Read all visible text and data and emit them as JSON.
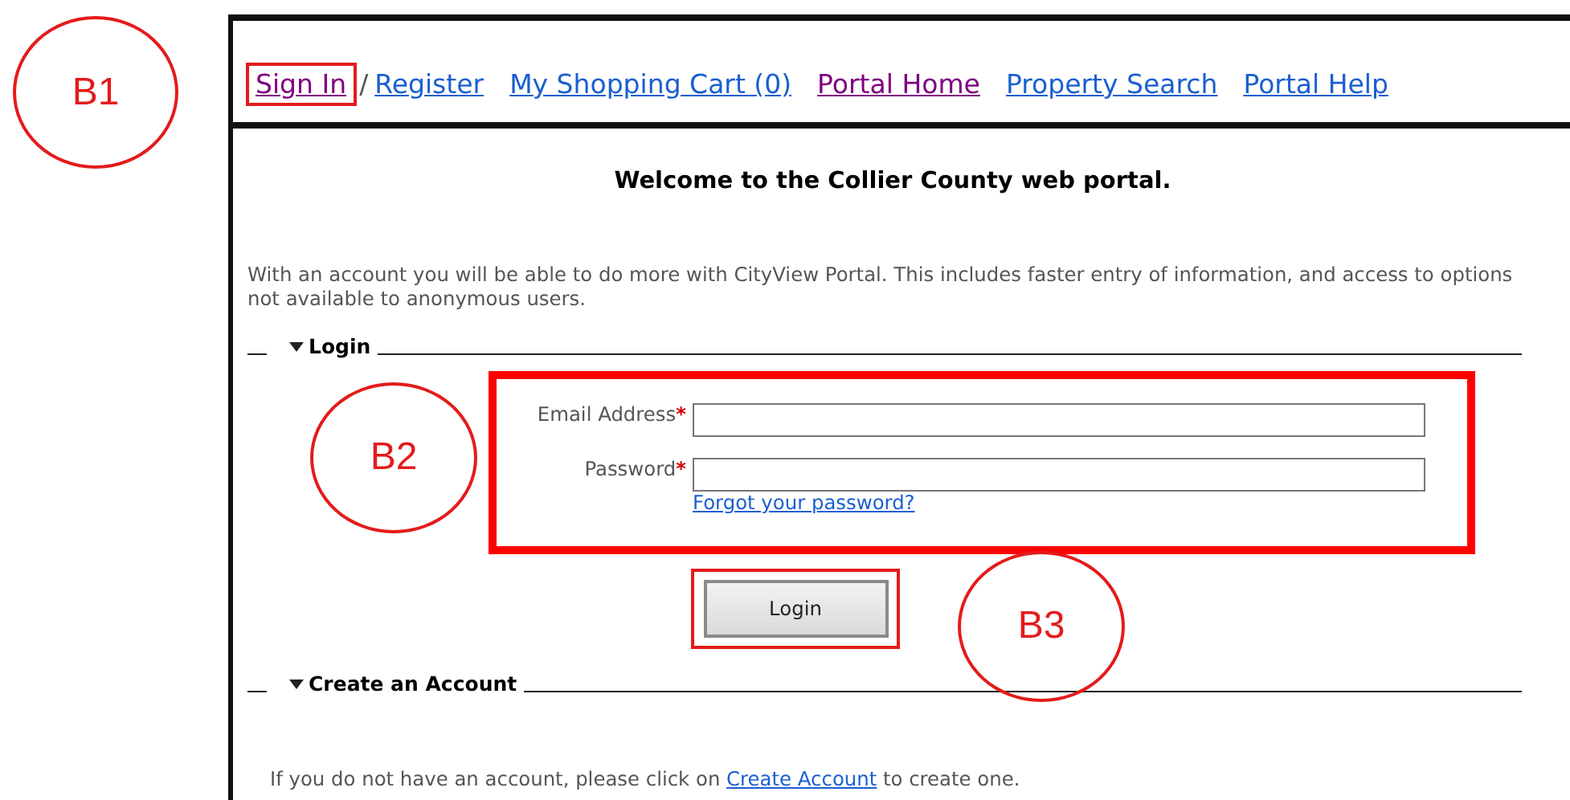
{
  "nav": {
    "callout": "B1",
    "links": [
      {
        "kind": "link",
        "label": "Sign In",
        "visited": true,
        "highlighted": true
      },
      {
        "kind": "separator",
        "label": "/"
      },
      {
        "kind": "link",
        "label": "Register",
        "visited": false,
        "highlighted": false
      },
      {
        "kind": "link",
        "label": "My Shopping Cart (0)",
        "visited": false,
        "highlighted": false
      },
      {
        "kind": "link",
        "label": "Portal Home",
        "visited": true,
        "highlighted": false
      },
      {
        "kind": "link",
        "label": "Property Search",
        "visited": false,
        "highlighted": false
      },
      {
        "kind": "link",
        "label": "Portal Help",
        "visited": false,
        "highlighted": false
      }
    ]
  },
  "heading": "Welcome to the Collier County web portal.",
  "intro": "With an account you will be able to do more with CityView Portal. This includes faster entry of information, and access to options not available to anonymous users.",
  "login": {
    "title": "Login",
    "expanded": true,
    "callout": "B2",
    "highlighted": true,
    "fields": [
      {
        "label": "Email Address",
        "required_mark": "*"
      },
      {
        "label": "Password",
        "required_mark": "*"
      }
    ],
    "forgot_link": "Forgot your password?",
    "button": {
      "label": "Login",
      "callout": "B3",
      "highlighted": true
    }
  },
  "create_account": {
    "title": "Create an Account",
    "expanded": true,
    "text_before": "If you do not have an account, please click on ",
    "link": "Create Account",
    "text_after": " to create one."
  }
}
